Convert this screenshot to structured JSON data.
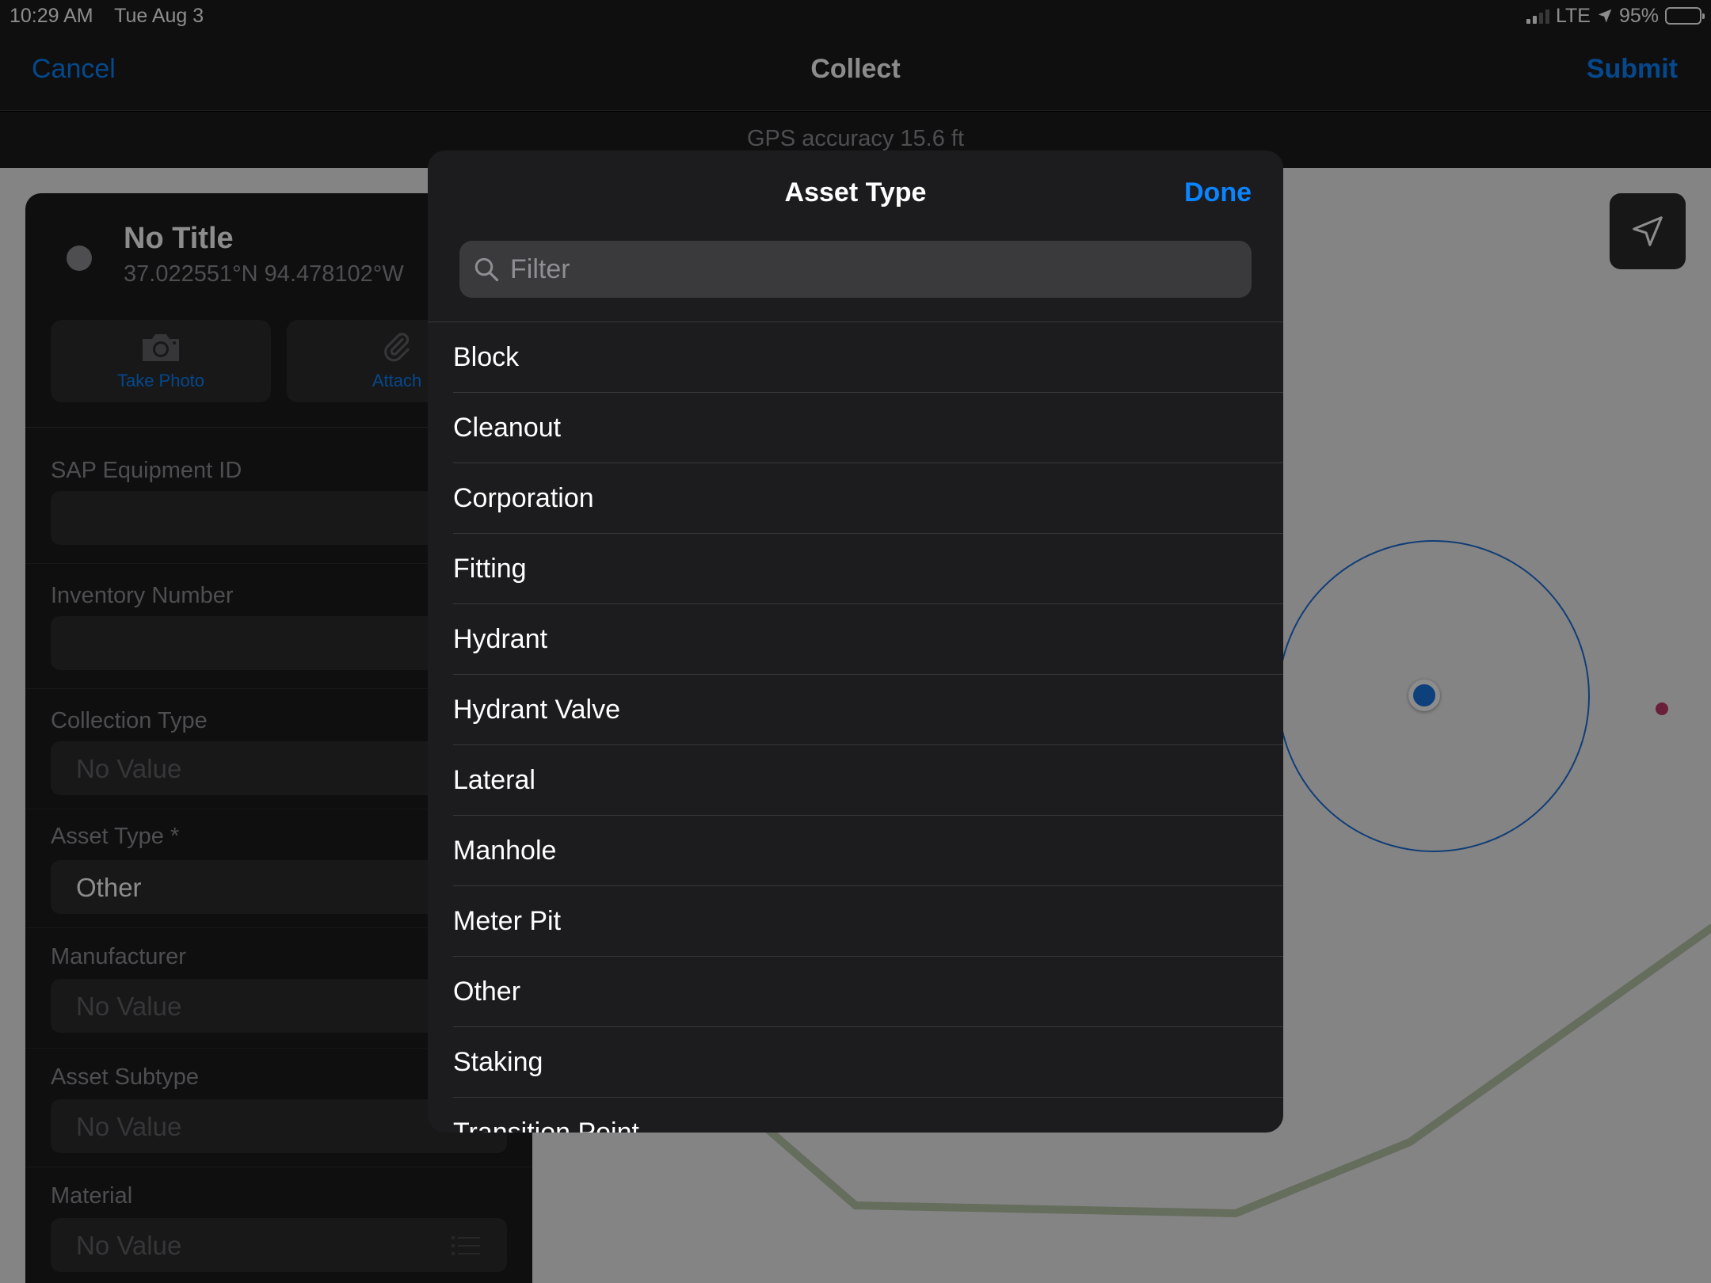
{
  "status_bar": {
    "time": "10:29 AM",
    "date": "Tue Aug 3",
    "network": "LTE",
    "battery": "95%"
  },
  "nav": {
    "cancel": "Cancel",
    "title": "Collect",
    "submit": "Submit"
  },
  "gps": {
    "text": "GPS accuracy 15.6 ft"
  },
  "feature": {
    "title": "No Title",
    "coords": "37.022551°N  94.478102°W",
    "actions": {
      "photo": "Take Photo",
      "attach": "Attach"
    }
  },
  "form": {
    "fields": [
      {
        "label": "SAP Equipment ID",
        "value": ""
      },
      {
        "label": "Inventory Number",
        "value": ""
      },
      {
        "label": "Collection Type",
        "value": "No Value"
      },
      {
        "label": "Asset Type *",
        "value": "Other"
      },
      {
        "label": "Manufacturer",
        "value": "No Value"
      },
      {
        "label": "Asset Subtype",
        "value": "No Value"
      },
      {
        "label": "Material",
        "value": "No Value"
      }
    ]
  },
  "popover": {
    "title": "Asset Type",
    "done": "Done",
    "filter_placeholder": "Filter",
    "options": [
      "Block",
      "Cleanout",
      "Corporation",
      "Fitting",
      "Hydrant",
      "Hydrant Valve",
      "Lateral",
      "Manhole",
      "Meter Pit",
      "Other",
      "Staking",
      "Transition Point"
    ]
  },
  "colors": {
    "accent": "#0a84ff",
    "accuracy_ring": "#1e6fd9",
    "location_dot": "#1b75e0",
    "map_point": "#c23a6a"
  }
}
